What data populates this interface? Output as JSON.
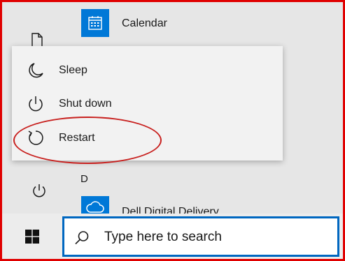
{
  "apps": {
    "calendar_label": "Calendar",
    "section_letter": "D",
    "dell_label": "Dell Digital Delivery"
  },
  "power_menu": {
    "items": [
      {
        "label": "Sleep",
        "icon": "moon-icon"
      },
      {
        "label": "Shut down",
        "icon": "power-icon"
      },
      {
        "label": "Restart",
        "icon": "restart-icon"
      }
    ]
  },
  "taskbar": {
    "search_placeholder": "Type here to search"
  },
  "colors": {
    "accent": "#0078d7",
    "annotation_red": "#e00000"
  }
}
